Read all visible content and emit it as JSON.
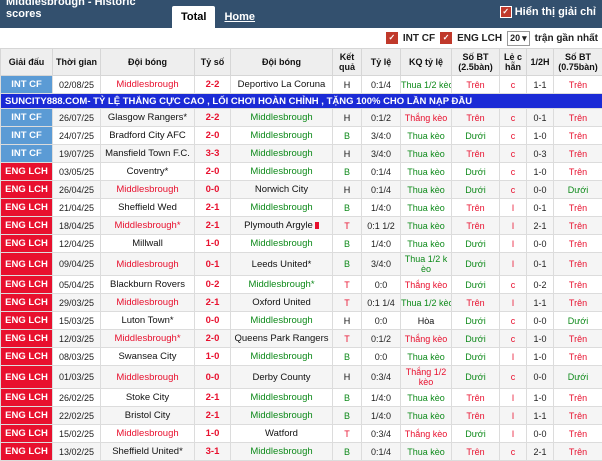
{
  "header": {
    "title": "Middlesbrough - Historic scores",
    "tabs": [
      {
        "label": "Total"
      },
      {
        "label": "Home"
      }
    ],
    "half_label": "Hiển thị giải chỉ"
  },
  "filters": {
    "league1": "INT CF",
    "league2": "ENG LCH",
    "count": "20",
    "trailing": "trận gần nhất"
  },
  "columns": [
    "Giải đấu",
    "Thời gian",
    "Đội bóng",
    "Tỷ số",
    "Đội bóng",
    "Kết quả",
    "Tỷ lệ",
    "KQ tỷ lệ",
    "Số BT (2.5bàn)",
    "Lẻ c hẵn",
    "1/2H",
    "Số BT (0.75bàn)"
  ],
  "colors": {
    "int_cf": "#5b9bd5",
    "eng_lch": "#e8102e",
    "ad_bg": "#1b2bd6"
  },
  "ad_text": "SUNCITY888.COM- TỶ LỆ THẮNG CỰC CAO , LỐI CHƠI HOÀN CHỈNH , TẶNG 100% CHO LẦN NẠP ĐẦU",
  "rows": [
    {
      "league": "INT CF",
      "date": "02/08/25",
      "home": "Middlesbrough",
      "home_c": "t-red",
      "score": "2-2",
      "away": "Deportivo La Coruna",
      "away_c": "t-normal",
      "res": "H",
      "odds": "0:1/4",
      "kq": "Thua 1/2 kèo",
      "kq_c": "t-green",
      "bt": "Trên",
      "bt_c": "t-red",
      "lc": "c",
      "h1": "1-1",
      "bt2": "Trên",
      "bt2_c": "t-red"
    },
    {
      "league": "INT CF",
      "date": "26/07/25",
      "home": "Glasgow Rangers",
      "home_c": "t-normal",
      "home_mark": "*",
      "score": "2-2",
      "away": "Middlesbrough",
      "away_c": "t-green",
      "res": "H",
      "odds": "0:1/2",
      "kq": "Thắng kèo",
      "kq_c": "t-red",
      "bt": "Trên",
      "bt_c": "t-red",
      "lc": "c",
      "h1": "0-1",
      "bt2": "Trên",
      "bt2_c": "t-red"
    },
    {
      "league": "INT CF",
      "date": "24/07/25",
      "home": "Bradford City AFC",
      "home_c": "t-normal",
      "score": "2-0",
      "away": "Middlesbrough",
      "away_c": "t-green",
      "res": "B",
      "odds": "3/4:0",
      "kq": "Thua kèo",
      "kq_c": "t-green",
      "bt": "Dưới",
      "bt_c": "t-green",
      "lc": "c",
      "h1": "1-0",
      "bt2": "Trên",
      "bt2_c": "t-red"
    },
    {
      "league": "INT CF",
      "date": "19/07/25",
      "home": "Mansfield Town F.C.",
      "home_c": "t-normal",
      "score": "3-3",
      "away": "Middlesbrough",
      "away_c": "t-green",
      "res": "H",
      "odds": "3/4:0",
      "kq": "Thua kèo",
      "kq_c": "t-green",
      "bt": "Trên",
      "bt_c": "t-red",
      "lc": "c",
      "h1": "0-3",
      "bt2": "Trên",
      "bt2_c": "t-red"
    },
    {
      "league": "ENG LCH",
      "date": "03/05/25",
      "home": "Coventry",
      "home_c": "t-normal",
      "home_mark": "*",
      "score": "2-0",
      "away": "Middlesbrough",
      "away_c": "t-green",
      "res": "B",
      "odds": "0:1/4",
      "kq": "Thua kèo",
      "kq_c": "t-green",
      "bt": "Dưới",
      "bt_c": "t-green",
      "lc": "c",
      "h1": "1-0",
      "bt2": "Trên",
      "bt2_c": "t-red"
    },
    {
      "league": "ENG LCH",
      "date": "26/04/25",
      "home": "Middlesbrough",
      "home_c": "t-red",
      "score": "0-0",
      "away": "Norwich City",
      "away_c": "t-normal",
      "res": "H",
      "odds": "0:1/4",
      "kq": "Thua kèo",
      "kq_c": "t-green",
      "bt": "Dưới",
      "bt_c": "t-green",
      "lc": "c",
      "h1": "0-0",
      "bt2": "Dưới",
      "bt2_c": "t-green"
    },
    {
      "league": "ENG LCH",
      "date": "21/04/25",
      "home": "Sheffield Wed",
      "home_c": "t-normal",
      "score": "2-1",
      "away": "Middlesbrough",
      "away_c": "t-green",
      "res": "B",
      "odds": "1/4:0",
      "kq": "Thua kèo",
      "kq_c": "t-green",
      "bt": "Trên",
      "bt_c": "t-red",
      "lc": "l",
      "h1": "0-1",
      "bt2": "Trên",
      "bt2_c": "t-red"
    },
    {
      "league": "ENG LCH",
      "date": "18/04/25",
      "home": "Middlesbrough",
      "home_c": "t-red",
      "home_mark": "*",
      "score": "2-1",
      "away": "Plymouth Argyle",
      "away_c": "t-normal",
      "away_redcard": true,
      "res": "T",
      "odds": "0:1 1/2",
      "kq": "Thua kèo",
      "kq_c": "t-green",
      "bt": "Trên",
      "bt_c": "t-red",
      "lc": "l",
      "h1": "2-1",
      "bt2": "Trên",
      "bt2_c": "t-red"
    },
    {
      "league": "ENG LCH",
      "date": "12/04/25",
      "home": "Millwall",
      "home_c": "t-normal",
      "score": "1-0",
      "away": "Middlesbrough",
      "away_c": "t-green",
      "res": "B",
      "odds": "1/4:0",
      "kq": "Thua kèo",
      "kq_c": "t-green",
      "bt": "Dưới",
      "bt_c": "t-green",
      "lc": "l",
      "h1": "0-0",
      "bt2": "Trên",
      "bt2_c": "t-red"
    },
    {
      "league": "ENG LCH",
      "date": "09/04/25",
      "home": "Middlesbrough",
      "home_c": "t-red",
      "score": "0-1",
      "away": "Leeds United",
      "away_c": "t-normal",
      "away_mark": "*",
      "res": "B",
      "odds": "3/4:0",
      "kq": "Thua 1/2 k èo",
      "kq_c": "t-green",
      "bt": "Dưới",
      "bt_c": "t-green",
      "lc": "l",
      "h1": "0-1",
      "bt2": "Trên",
      "bt2_c": "t-red",
      "tall": true
    },
    {
      "league": "ENG LCH",
      "date": "05/04/25",
      "home": "Blackburn Rovers",
      "home_c": "t-normal",
      "score": "0-2",
      "away": "Middlesbrough",
      "away_c": "t-green",
      "away_mark": "*",
      "res": "T",
      "odds": "0:0",
      "kq": "Thắng kèo",
      "kq_c": "t-red",
      "bt": "Dưới",
      "bt_c": "t-green",
      "lc": "c",
      "h1": "0-2",
      "bt2": "Trên",
      "bt2_c": "t-red"
    },
    {
      "league": "ENG LCH",
      "date": "29/03/25",
      "home": "Middlesbrough",
      "home_c": "t-red",
      "score": "2-1",
      "away": "Oxford United",
      "away_c": "t-normal",
      "res": "T",
      "odds": "0:1 1/4",
      "kq": "Thua 1/2 kèo",
      "kq_c": "t-green",
      "bt": "Trên",
      "bt_c": "t-red",
      "lc": "l",
      "h1": "1-1",
      "bt2": "Trên",
      "bt2_c": "t-red"
    },
    {
      "league": "ENG LCH",
      "date": "15/03/25",
      "home": "Luton Town",
      "home_c": "t-normal",
      "home_mark": "*",
      "score": "0-0",
      "away": "Middlesbrough",
      "away_c": "t-green",
      "res": "H",
      "odds": "0:0",
      "kq": "Hòa",
      "kq_c": "t-normal",
      "bt": "Dưới",
      "bt_c": "t-green",
      "lc": "c",
      "h1": "0-0",
      "bt2": "Dưới",
      "bt2_c": "t-green"
    },
    {
      "league": "ENG LCH",
      "date": "12/03/25",
      "home": "Middlesbrough",
      "home_c": "t-red",
      "home_mark": "*",
      "score": "2-0",
      "away": "Queens Park Rangers",
      "away_c": "t-normal",
      "res": "T",
      "odds": "0:1/2",
      "kq": "Thắng kèo",
      "kq_c": "t-red",
      "bt": "Dưới",
      "bt_c": "t-green",
      "lc": "c",
      "h1": "1-0",
      "bt2": "Trên",
      "bt2_c": "t-red"
    },
    {
      "league": "ENG LCH",
      "date": "08/03/25",
      "home": "Swansea City",
      "home_c": "t-normal",
      "score": "1-0",
      "away": "Middlesbrough",
      "away_c": "t-green",
      "res": "B",
      "odds": "0:0",
      "kq": "Thua kèo",
      "kq_c": "t-green",
      "bt": "Dưới",
      "bt_c": "t-green",
      "lc": "l",
      "h1": "1-0",
      "bt2": "Trên",
      "bt2_c": "t-red"
    },
    {
      "league": "ENG LCH",
      "date": "01/03/25",
      "home": "Middlesbrough",
      "home_c": "t-red",
      "score": "0-0",
      "away": "Derby County",
      "away_c": "t-normal",
      "res": "H",
      "odds": "0:3/4",
      "kq": "Thắng 1/2 kèo",
      "kq_c": "t-red",
      "bt": "Dưới",
      "bt_c": "t-green",
      "lc": "c",
      "h1": "0-0",
      "bt2": "Dưới",
      "bt2_c": "t-green",
      "tall": true
    },
    {
      "league": "ENG LCH",
      "date": "26/02/25",
      "home": "Stoke City",
      "home_c": "t-normal",
      "score": "2-1",
      "away": "Middlesbrough",
      "away_c": "t-green",
      "res": "B",
      "odds": "1/4:0",
      "kq": "Thua kèo",
      "kq_c": "t-green",
      "bt": "Trên",
      "bt_c": "t-red",
      "lc": "l",
      "h1": "1-0",
      "bt2": "Trên",
      "bt2_c": "t-red"
    },
    {
      "league": "ENG LCH",
      "date": "22/02/25",
      "home": "Bristol City",
      "home_c": "t-normal",
      "score": "2-1",
      "away": "Middlesbrough",
      "away_c": "t-green",
      "res": "B",
      "odds": "1/4:0",
      "kq": "Thua kèo",
      "kq_c": "t-green",
      "bt": "Trên",
      "bt_c": "t-red",
      "lc": "l",
      "h1": "1-1",
      "bt2": "Trên",
      "bt2_c": "t-red"
    },
    {
      "league": "ENG LCH",
      "date": "15/02/25",
      "home": "Middlesbrough",
      "home_c": "t-red",
      "score": "1-0",
      "away": "Watford",
      "away_c": "t-normal",
      "res": "T",
      "odds": "0:3/4",
      "kq": "Thắng kèo",
      "kq_c": "t-red",
      "bt": "Dưới",
      "bt_c": "t-green",
      "lc": "l",
      "h1": "0-0",
      "bt2": "Trên",
      "bt2_c": "t-red"
    },
    {
      "league": "ENG LCH",
      "date": "13/02/25",
      "home": "Sheffield United",
      "home_c": "t-normal",
      "home_mark": "*",
      "score": "3-1",
      "away": "Middlesbrough",
      "away_c": "t-green",
      "res": "B",
      "odds": "0:1/4",
      "kq": "Thua kèo",
      "kq_c": "t-green",
      "bt": "Trên",
      "bt_c": "t-red",
      "lc": "c",
      "h1": "2-1",
      "bt2": "Trên",
      "bt2_c": "t-red"
    }
  ]
}
